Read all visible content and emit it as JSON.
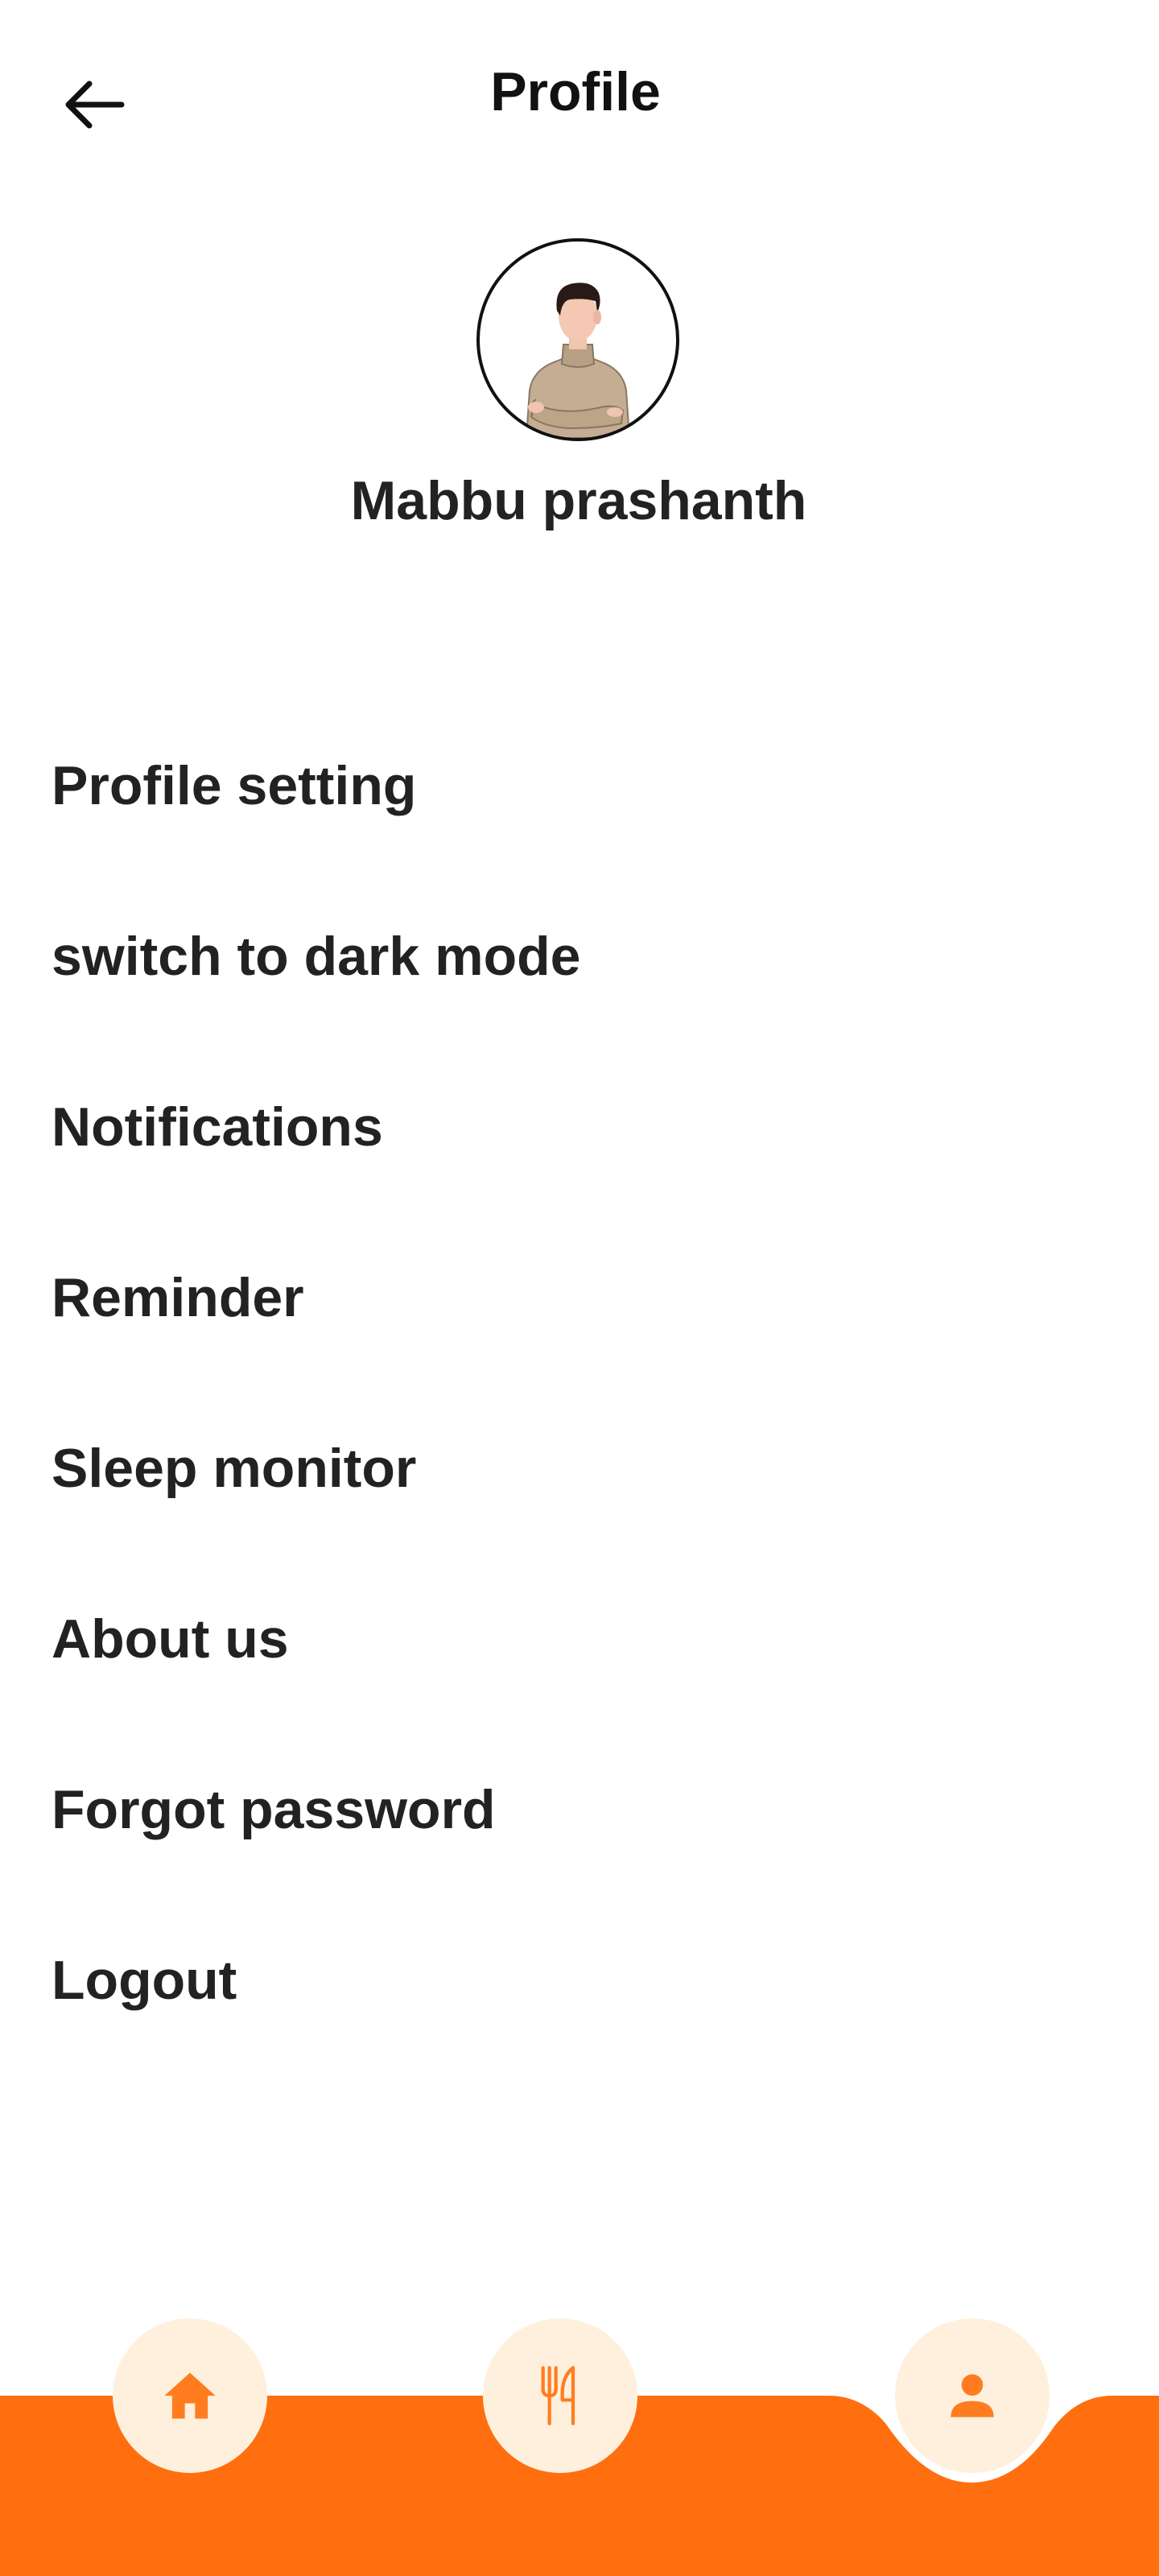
{
  "header": {
    "title": "Profile",
    "back_icon": "arrow-left-icon"
  },
  "profile": {
    "name": "Mabbu prashanth",
    "avatar": "person-avatar-illustration"
  },
  "menu": {
    "items": [
      {
        "label": "Profile setting"
      },
      {
        "label": "switch to dark mode"
      },
      {
        "label": "Notifications"
      },
      {
        "label": "Reminder"
      },
      {
        "label": "Sleep monitor"
      },
      {
        "label": "About us"
      },
      {
        "label": "Forgot password"
      },
      {
        "label": "Logout"
      }
    ]
  },
  "bottom_nav": {
    "items": [
      {
        "icon": "home-icon"
      },
      {
        "icon": "fork-knife-icon"
      },
      {
        "icon": "person-icon",
        "active": true
      }
    ]
  },
  "colors": {
    "accent": "#ff6f0f",
    "nav_button_bg": "#fff0de",
    "text": "#222222"
  }
}
